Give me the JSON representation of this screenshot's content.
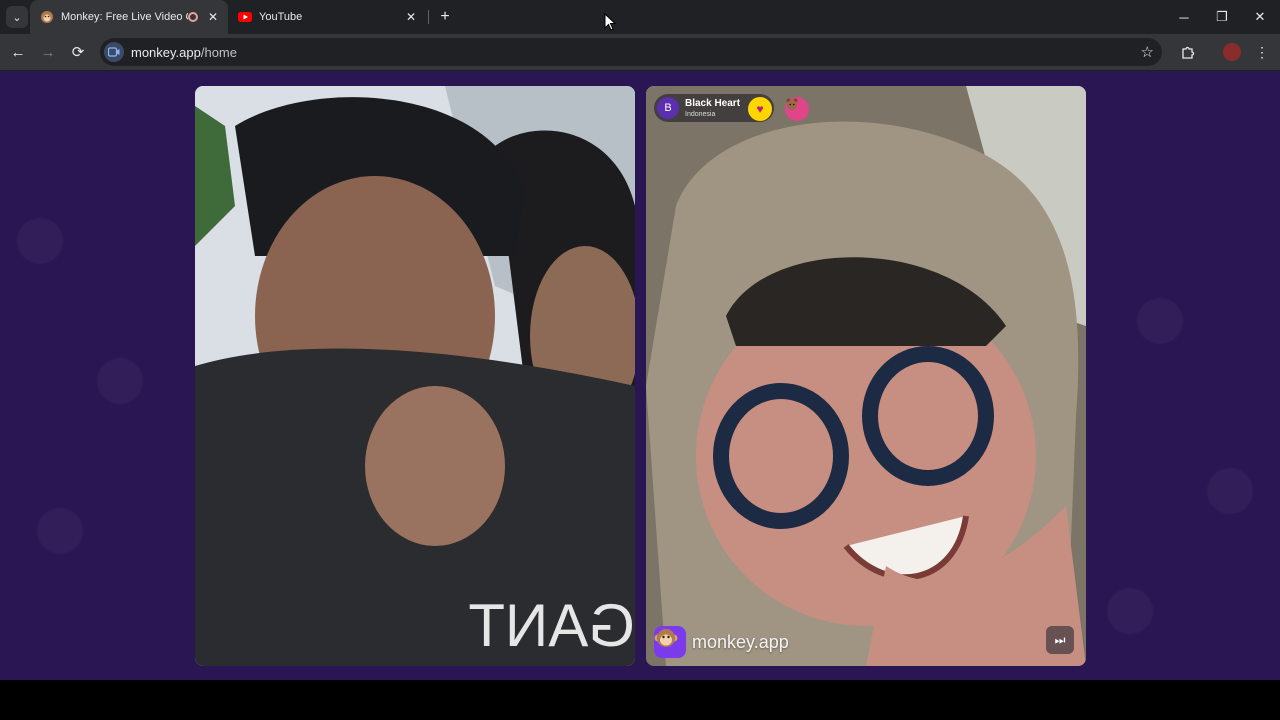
{
  "browser": {
    "tabs": [
      {
        "title": "Monkey: Free Live Video Cl",
        "active": true,
        "favicon": "monkey-icon",
        "audio": true
      },
      {
        "title": "YouTube",
        "active": false,
        "favicon": "youtube-icon"
      }
    ],
    "new_tab_label": "+",
    "window_controls": {
      "minimize": "─",
      "restore": "❐",
      "close": "✕"
    }
  },
  "toolbar": {
    "back": "←",
    "forward": "→",
    "reload": "⟳",
    "url_host": "monkey.app",
    "url_path": "/home",
    "bookmark_icon": "star-icon",
    "extensions_icon": "puzzle-icon",
    "menu_icon": "kebab-menu-icon"
  },
  "remote_user": {
    "initial": "B",
    "name": "Black Heart",
    "country": "Indonesia",
    "heart_badge": "♥",
    "bear_badge": "ʕ•ᴥ•ʔ"
  },
  "brand": {
    "logo": "🐵",
    "text": "monkey.app"
  },
  "controls": {
    "skip": "⏭"
  },
  "colors": {
    "page_bg": "#2a1653",
    "brand_purple": "#7c3aed",
    "heart_yellow": "#ffd600"
  }
}
